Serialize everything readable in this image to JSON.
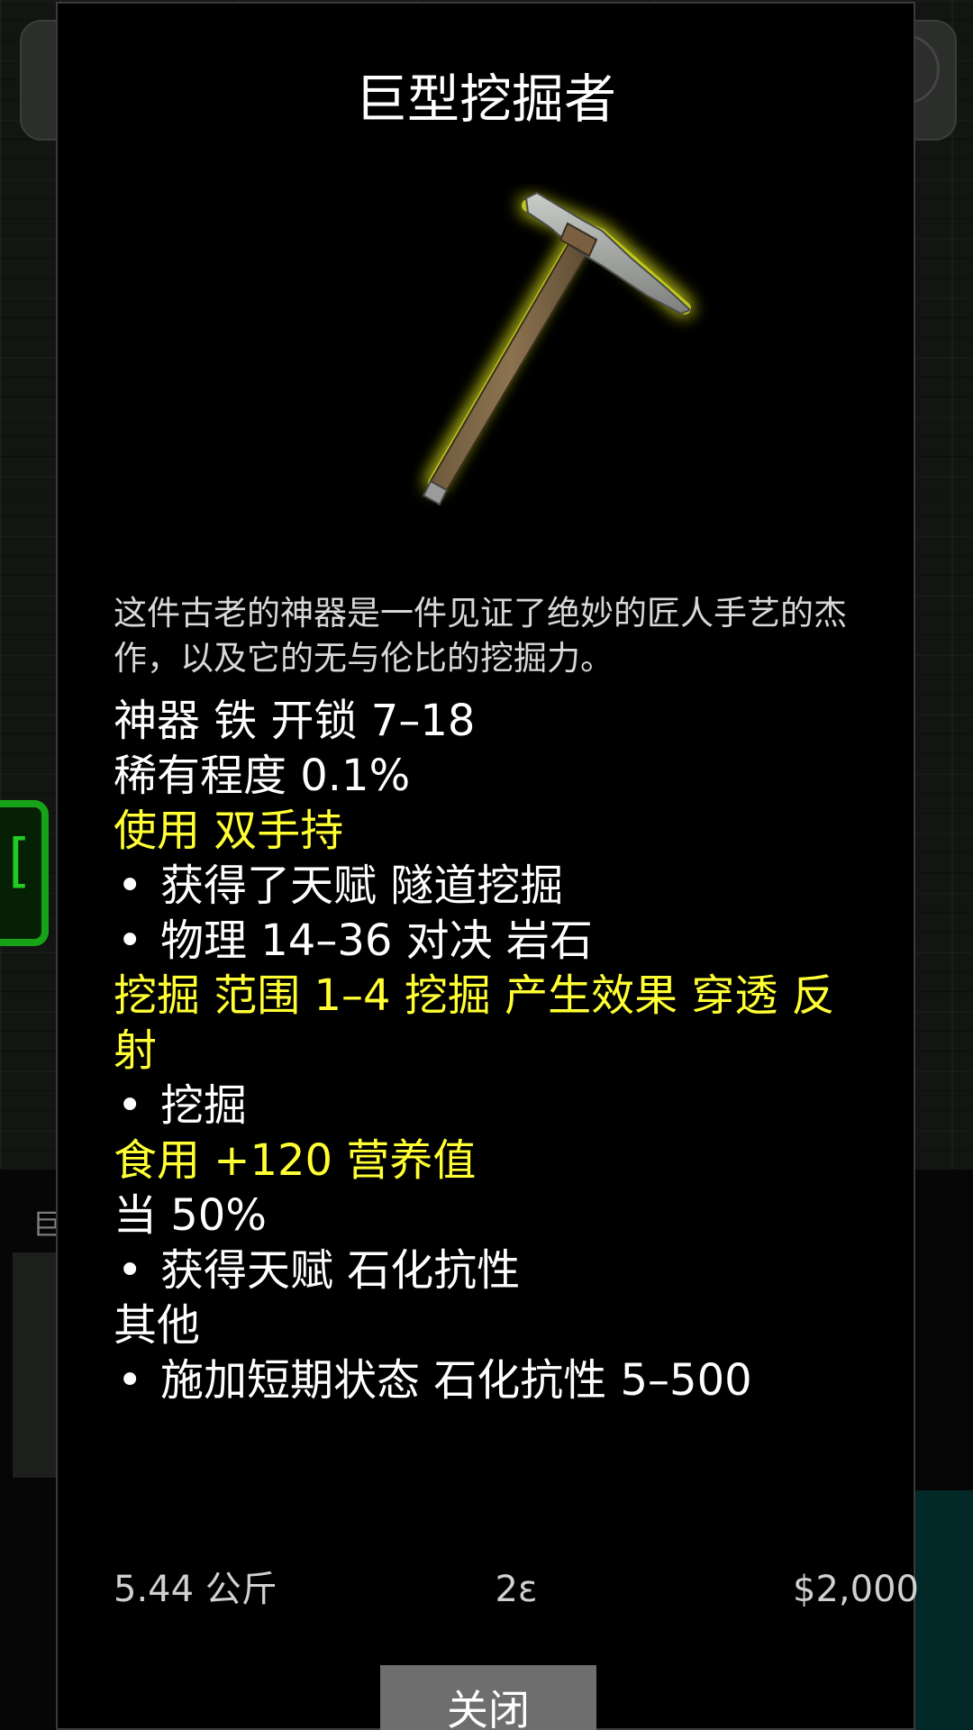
{
  "item": {
    "title": "巨型挖掘者",
    "description": "这件古老的神器是一件见证了绝妙的匠人手艺的杰作，以及它的无与伦比的挖掘力。",
    "lines": [
      {
        "text": "神器 铁 开锁 7–18",
        "style": "white",
        "bullet": false
      },
      {
        "text": "稀有程度 0.1%",
        "style": "white",
        "bullet": false
      },
      {
        "text": "使用 双手持",
        "style": "yellow",
        "bullet": false
      },
      {
        "text": "获得了天赋 隧道挖掘",
        "style": "white",
        "bullet": true
      },
      {
        "text": "物理 14–36 对决 岩石",
        "style": "white",
        "bullet": true
      },
      {
        "text": "挖掘 范围 1–4 挖掘 产生效果 穿透 反射",
        "style": "yellow",
        "bullet": false
      },
      {
        "text": "挖掘",
        "style": "white",
        "bullet": true
      },
      {
        "text": "食用 +120 营养值",
        "style": "yellow",
        "bullet": false
      },
      {
        "text": "当 50%",
        "style": "white",
        "bullet": false
      },
      {
        "text": "获得天赋 石化抗性",
        "style": "white",
        "bullet": true
      },
      {
        "text": "其他",
        "style": "white",
        "bullet": false
      },
      {
        "text": "施加短期状态 石化抗性 5–500",
        "style": "white",
        "bullet": true
      }
    ],
    "footer": {
      "weight": "5.44 公斤",
      "energy": "2ε",
      "price": "$2,000"
    },
    "icon": "pickaxe-icon"
  },
  "close_label": "关闭",
  "bullet_char": "•",
  "background": {
    "left_button_glyph": "[",
    "bottom_label": "巨"
  },
  "colors": {
    "highlight": "#ffff33",
    "text": "#ffffff",
    "modal_bg": "#000000",
    "button_bg": "#6e6e6e",
    "glow": "#c8d020"
  }
}
